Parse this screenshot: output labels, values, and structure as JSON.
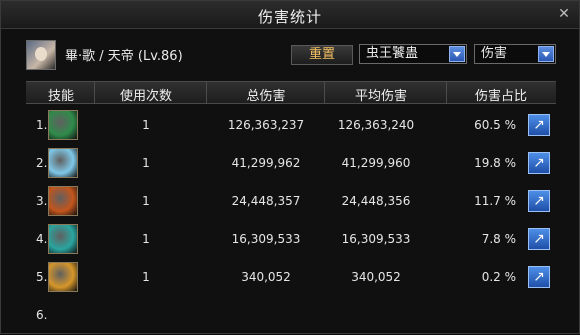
{
  "window": {
    "title": "伤害统计"
  },
  "player": {
    "name": "畢‧歌 / 天帝 (Lv.86)"
  },
  "controls": {
    "reset_label": "重置",
    "target_select": "虫王饕蛊",
    "metric_select": "伤害"
  },
  "table": {
    "headers": [
      "技能",
      "使用次数",
      "总伤害",
      "平均伤害",
      "伤害占比"
    ],
    "rows": [
      {
        "index": "1.",
        "uses": "1",
        "total": "126,363,237",
        "avg": "126,363,240",
        "pct": "60.5 %",
        "icon_name": "green-rune-skill-icon",
        "icon_color": "#2f8b4a"
      },
      {
        "index": "2.",
        "uses": "1",
        "total": "41,299,962",
        "avg": "41,299,960",
        "pct": "19.8 %",
        "icon_name": "ice-crystal-skill-icon",
        "icon_color": "#7fc8e8"
      },
      {
        "index": "3.",
        "uses": "1",
        "total": "24,448,357",
        "avg": "24,448,356",
        "pct": "11.7 %",
        "icon_name": "fire-orb-skill-icon",
        "icon_color": "#c3551d"
      },
      {
        "index": "4.",
        "uses": "1",
        "total": "16,309,533",
        "avg": "16,309,533",
        "pct": "7.8 %",
        "icon_name": "lightning-skill-icon",
        "icon_color": "#2aa5a0"
      },
      {
        "index": "5.",
        "uses": "1",
        "total": "340,052",
        "avg": "340,052",
        "pct": "0.2 %",
        "icon_name": "flame-strike-skill-icon",
        "icon_color": "#d6962a"
      },
      {
        "index": "6."
      }
    ]
  }
}
